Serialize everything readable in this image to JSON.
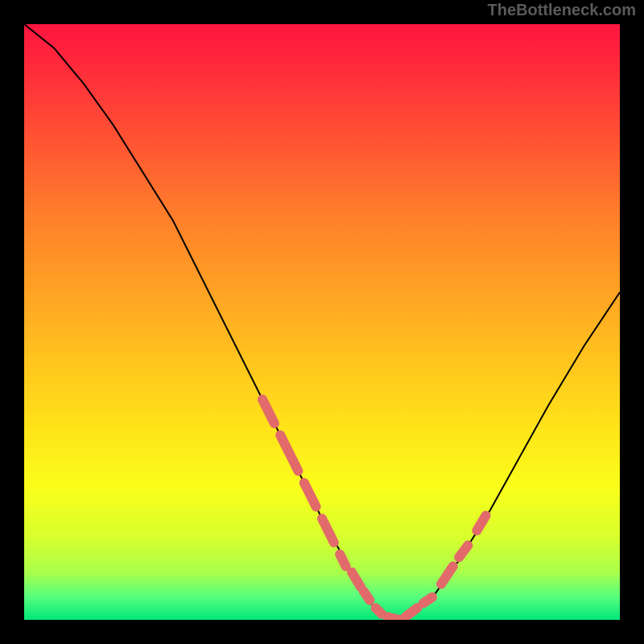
{
  "watermark": "TheBottleneck.com",
  "chart_data": {
    "type": "line",
    "title": "",
    "xlabel": "",
    "ylabel": "",
    "xlim": [
      0,
      100
    ],
    "ylim": [
      0,
      100
    ],
    "series": [
      {
        "name": "bottleneck-curve",
        "x": [
          0,
          5,
          10,
          15,
          20,
          25,
          30,
          35,
          40,
          45,
          50,
          55,
          58,
          60,
          63,
          68,
          73,
          78,
          83,
          88,
          94,
          100
        ],
        "values": [
          100,
          96,
          90,
          83,
          75,
          67,
          57,
          47,
          37,
          27,
          17,
          8,
          3,
          1,
          0,
          3,
          10,
          18,
          27,
          36,
          46,
          55
        ]
      }
    ],
    "highlight_segments": [
      {
        "x": [
          40,
          42
        ],
        "y": [
          37,
          33
        ]
      },
      {
        "x": [
          43,
          46
        ],
        "y": [
          31,
          25
        ]
      },
      {
        "x": [
          47,
          49
        ],
        "y": [
          23,
          19
        ]
      },
      {
        "x": [
          50,
          52
        ],
        "y": [
          17,
          13
        ]
      },
      {
        "x": [
          53,
          54
        ],
        "y": [
          11,
          9
        ]
      },
      {
        "x": [
          55,
          56.5
        ],
        "y": [
          8,
          5.5
        ]
      },
      {
        "x": [
          57,
          58
        ],
        "y": [
          4.8,
          3.3
        ]
      },
      {
        "x": [
          59,
          60
        ],
        "y": [
          2,
          1
        ]
      },
      {
        "x": [
          61,
          63
        ],
        "y": [
          0.5,
          0
        ]
      },
      {
        "x": [
          64,
          66
        ],
        "y": [
          0.5,
          2
        ]
      },
      {
        "x": [
          67,
          68.5
        ],
        "y": [
          2.8,
          3.8
        ]
      },
      {
        "x": [
          70,
          72
        ],
        "y": [
          6,
          9
        ]
      },
      {
        "x": [
          73,
          74.5
        ],
        "y": [
          10.5,
          12.5
        ]
      },
      {
        "x": [
          76,
          77.5
        ],
        "y": [
          15,
          17.5
        ]
      }
    ],
    "gradient_stops": [
      {
        "pos": 0,
        "color": "#ff153f"
      },
      {
        "pos": 8,
        "color": "#ff2d3a"
      },
      {
        "pos": 20,
        "color": "#ff5532"
      },
      {
        "pos": 32,
        "color": "#ff7e2b"
      },
      {
        "pos": 44,
        "color": "#ffa024"
      },
      {
        "pos": 56,
        "color": "#ffc31e"
      },
      {
        "pos": 68,
        "color": "#ffe419"
      },
      {
        "pos": 78,
        "color": "#faff1a"
      },
      {
        "pos": 86,
        "color": "#d8ff2d"
      },
      {
        "pos": 92,
        "color": "#aaff4a"
      },
      {
        "pos": 96,
        "color": "#5aff7d"
      },
      {
        "pos": 100,
        "color": "#00e77a"
      }
    ],
    "colors": {
      "curve_stroke": "#000000",
      "highlight_stroke": "#e26a6a",
      "background": "#000000"
    }
  }
}
